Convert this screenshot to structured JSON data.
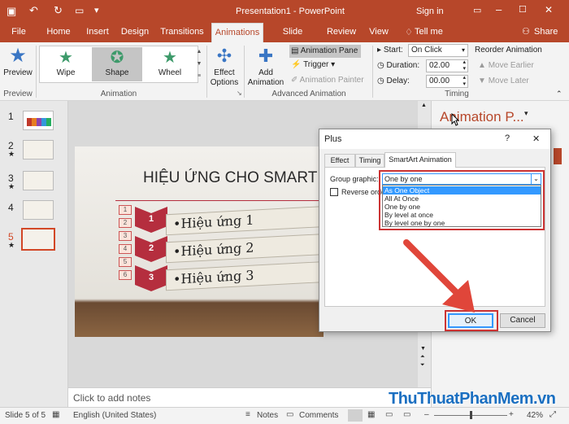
{
  "title": {
    "doc": "Presentation1 - PowerPoint",
    "signin": "Sign in"
  },
  "tabs": [
    "File",
    "Home",
    "Insert",
    "Design",
    "Transitions",
    "Animations",
    "Slide Show",
    "Review",
    "View"
  ],
  "tell_me": "Tell me",
  "share": "Share",
  "ribbon": {
    "preview": "Preview",
    "preview_group": "Preview",
    "animations": [
      "Wipe",
      "Shape",
      "Wheel"
    ],
    "animation_group": "Animation",
    "effect_options": [
      "Effect",
      "Options"
    ],
    "add_animation": [
      "Add",
      "Animation"
    ],
    "animation_pane": "Animation Pane",
    "trigger": "Trigger",
    "animation_painter": "Animation Painter",
    "advanced_group": "Advanced Animation",
    "start_label": "Start:",
    "start_value": "On Click",
    "duration_label": "Duration:",
    "duration_value": "02.00",
    "delay_label": "Delay:",
    "delay_value": "00.00",
    "reorder": "Reorder Animation",
    "move_earlier": "Move Earlier",
    "move_later": "Move Later",
    "timing_group": "Timing"
  },
  "thumbnails": [
    {
      "num": "1",
      "star": ""
    },
    {
      "num": "2",
      "star": "★"
    },
    {
      "num": "3",
      "star": "★"
    },
    {
      "num": "4",
      "star": ""
    },
    {
      "num": "5",
      "star": "★"
    }
  ],
  "slide": {
    "title": "HIỆU ỨNG CHO SMART",
    "steps": [
      "1",
      "2",
      "3",
      "4",
      "5",
      "6"
    ],
    "chevrons": [
      "1",
      "2",
      "3"
    ],
    "items": [
      "•Hiệu ứng 1",
      "•Hiệu ứng 2",
      "•Hiệu ứng 3"
    ]
  },
  "notes_placeholder": "Click to add notes",
  "pane_title": "Animation P...",
  "dialog": {
    "title": "Plus",
    "help": "?",
    "close": "✕",
    "tabs": [
      "Effect",
      "Timing",
      "SmartArt Animation"
    ],
    "group_label": "Group graphic:",
    "selected": "One by one",
    "reverse_label": "Reverse orde",
    "options": [
      "As One Object",
      "All At Once",
      "One by one",
      "By level at once",
      "By level one by one"
    ],
    "ok": "OK",
    "cancel": "Cancel"
  },
  "status": {
    "slide": "Slide 5 of 5",
    "lang": "English (United States)",
    "notes": "Notes",
    "comments": "Comments",
    "zoom": "42%"
  },
  "watermark": "ThuThuatPhanMem.vn",
  "colors": {
    "accent": "#b7472a",
    "highlight": "#cc3333",
    "selection": "#3399ff"
  }
}
